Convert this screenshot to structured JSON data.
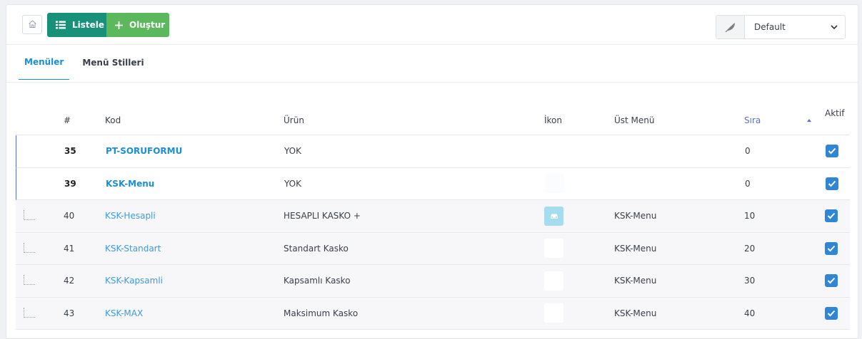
{
  "toolbar": {
    "list_label": "Listele",
    "create_label": "Oluştur",
    "style_selected": "Default"
  },
  "tabs": [
    {
      "label": "Menüler",
      "active": true
    },
    {
      "label": "Menü Stilleri",
      "active": false
    }
  ],
  "table": {
    "headers": {
      "num": "#",
      "kod": "Kod",
      "urun": "Ürün",
      "ikon": "İkon",
      "ust_menu": "Üst Menü",
      "sira": "Sıra",
      "aktif": "Aktif"
    },
    "rows": [
      {
        "num": "35",
        "kod": "PT-SORUFORMU",
        "urun": "YOK",
        "icon": "",
        "ust_menu": "",
        "sira": "0",
        "aktif": true,
        "level": "parent"
      },
      {
        "num": "39",
        "kod": "KSK-Menu",
        "urun": "YOK",
        "icon": "blank",
        "ust_menu": "",
        "sira": "0",
        "aktif": true,
        "level": "parent"
      },
      {
        "num": "40",
        "kod": "KSK-Hesapli",
        "urun": "HESAPLI KASKO +",
        "icon": "car-icon",
        "ust_menu": "KSK-Menu",
        "sira": "10",
        "aktif": true,
        "level": "child"
      },
      {
        "num": "41",
        "kod": "KSK-Standart",
        "urun": "Standart Kasko",
        "icon": "blank",
        "ust_menu": "KSK-Menu",
        "sira": "20",
        "aktif": true,
        "level": "child"
      },
      {
        "num": "42",
        "kod": "KSK-Kapsamli",
        "urun": "Kapsamlı Kasko",
        "icon": "blank",
        "ust_menu": "KSK-Menu",
        "sira": "30",
        "aktif": true,
        "level": "child"
      },
      {
        "num": "43",
        "kod": "KSK-MAX",
        "urun": "Maksimum Kasko",
        "icon": "blank",
        "ust_menu": "KSK-Menu",
        "sira": "40",
        "aktif": true,
        "level": "child"
      }
    ]
  },
  "colors": {
    "accent": "#1a8fd6",
    "list_button": "#17917a",
    "create_button": "#5cb85c",
    "checkbox": "#2f86d6"
  }
}
